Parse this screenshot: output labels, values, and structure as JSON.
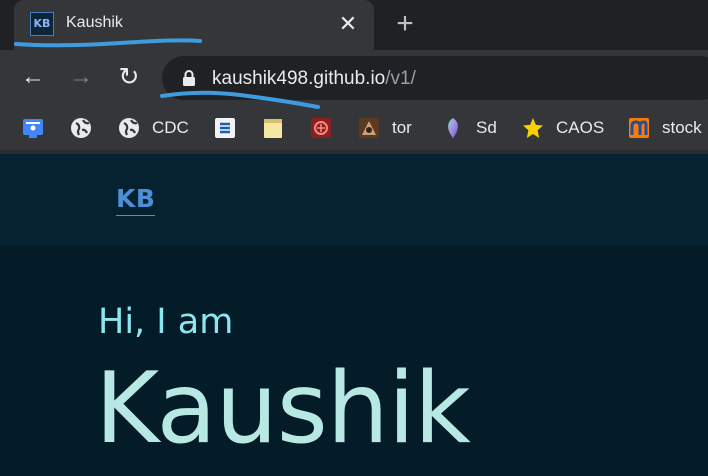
{
  "browser": {
    "tab": {
      "favicon_text": "KB",
      "title": "Kaushik",
      "close_glyph": "✕"
    },
    "new_tab_glyph": "+",
    "nav": {
      "back_glyph": "←",
      "forward_glyph": "→",
      "reload_glyph": "↻"
    },
    "address": {
      "host": "kaushik498.github.io",
      "path": "/v1/"
    },
    "bookmarks": [
      {
        "label": "",
        "icon": "blue-app-icon"
      },
      {
        "label": "",
        "icon": "globe-icon"
      },
      {
        "label": "CDC",
        "icon": "globe-icon"
      },
      {
        "label": "",
        "icon": "stack-icon"
      },
      {
        "label": "",
        "icon": "notepad-icon"
      },
      {
        "label": "",
        "icon": "red-logo-icon"
      },
      {
        "label": "tor",
        "icon": "tor-icon"
      },
      {
        "label": "Sd",
        "icon": "gem-icon"
      },
      {
        "label": "CAOS",
        "icon": "star-icon"
      },
      {
        "label": "stock",
        "icon": "stock-icon"
      }
    ]
  },
  "page": {
    "logo": "KB",
    "greeting": "Hi, I am",
    "name": "Kaushik"
  },
  "colors": {
    "annotation_stroke": "#3d9be0",
    "logo": "#4e8fd3",
    "greeting": "#8de5ef",
    "hero_name": "#b8e8e4",
    "page_bg": "#041b28"
  }
}
